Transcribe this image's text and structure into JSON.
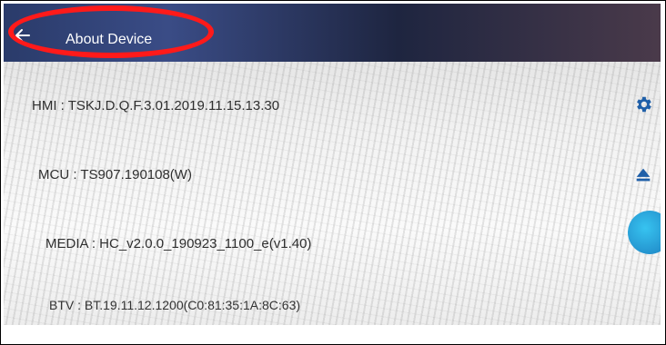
{
  "header": {
    "title": "About Device",
    "back_icon": "arrow-left-icon"
  },
  "info_rows": [
    {
      "text": "HMI : TSKJ.D.Q.F.3.01.2019.11.15.13.30"
    },
    {
      "text": "MCU : TS907.190108(W)"
    },
    {
      "text": "MEDIA : HC_v2.0.0_190923_1100_e(v1.40)"
    },
    {
      "text": "BTV : BT.19.11.12.1200(C0:81:35:1A:8C:63)"
    }
  ],
  "side_controls": {
    "gear_icon": "gear-icon",
    "eject_icon": "eject-icon",
    "float_icon": "assistive-touch-icon"
  },
  "colors": {
    "header_bg": "#2a3b6a",
    "highlight_ring": "#ff1a1a",
    "accent_blue": "#1c7fc0"
  }
}
